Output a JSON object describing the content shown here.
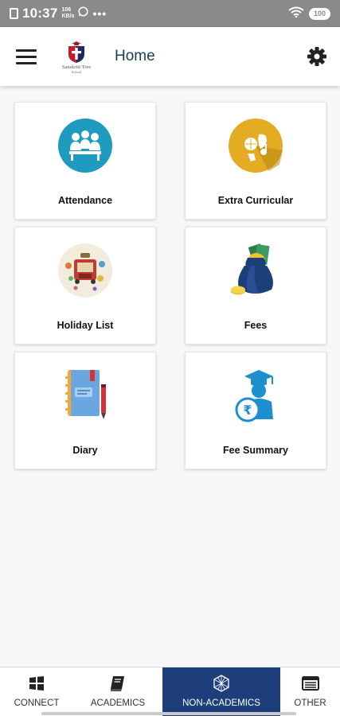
{
  "status_bar": {
    "time": "10:37",
    "speed_value": "106",
    "speed_unit": "KB/s",
    "dots": "•••",
    "battery": "100"
  },
  "header": {
    "title": "Home",
    "logo_name": "Sanskriti Tree",
    "logo_sub": "School",
    "menu_icon": "hamburger-icon",
    "settings_icon": "gear-icon"
  },
  "cards": [
    {
      "label": "Attendance",
      "icon": "attendance-icon"
    },
    {
      "label": "Extra Curricular",
      "icon": "extra-curricular-icon"
    },
    {
      "label": "Holiday List",
      "icon": "holiday-list-icon"
    },
    {
      "label": "Fees",
      "icon": "fees-icon"
    },
    {
      "label": "Diary",
      "icon": "diary-icon"
    },
    {
      "label": "Fee Summary",
      "icon": "fee-summary-icon"
    }
  ],
  "bottom_nav": [
    {
      "label": "CONNECT",
      "icon": "windows-grid-icon",
      "active": false
    },
    {
      "label": "ACADEMICS",
      "icon": "book-icon",
      "active": false
    },
    {
      "label": "NON-ACADEMICS",
      "icon": "polygon-icon",
      "active": true
    },
    {
      "label": "OTHER",
      "icon": "list-window-icon",
      "active": false
    }
  ],
  "colors": {
    "status_bar": "#8a8a8a",
    "title": "#1d3b5a",
    "active_nav": "#1d3e7a",
    "attendance": "#1f9bc0",
    "extra_curricular": "#e3ac23"
  }
}
